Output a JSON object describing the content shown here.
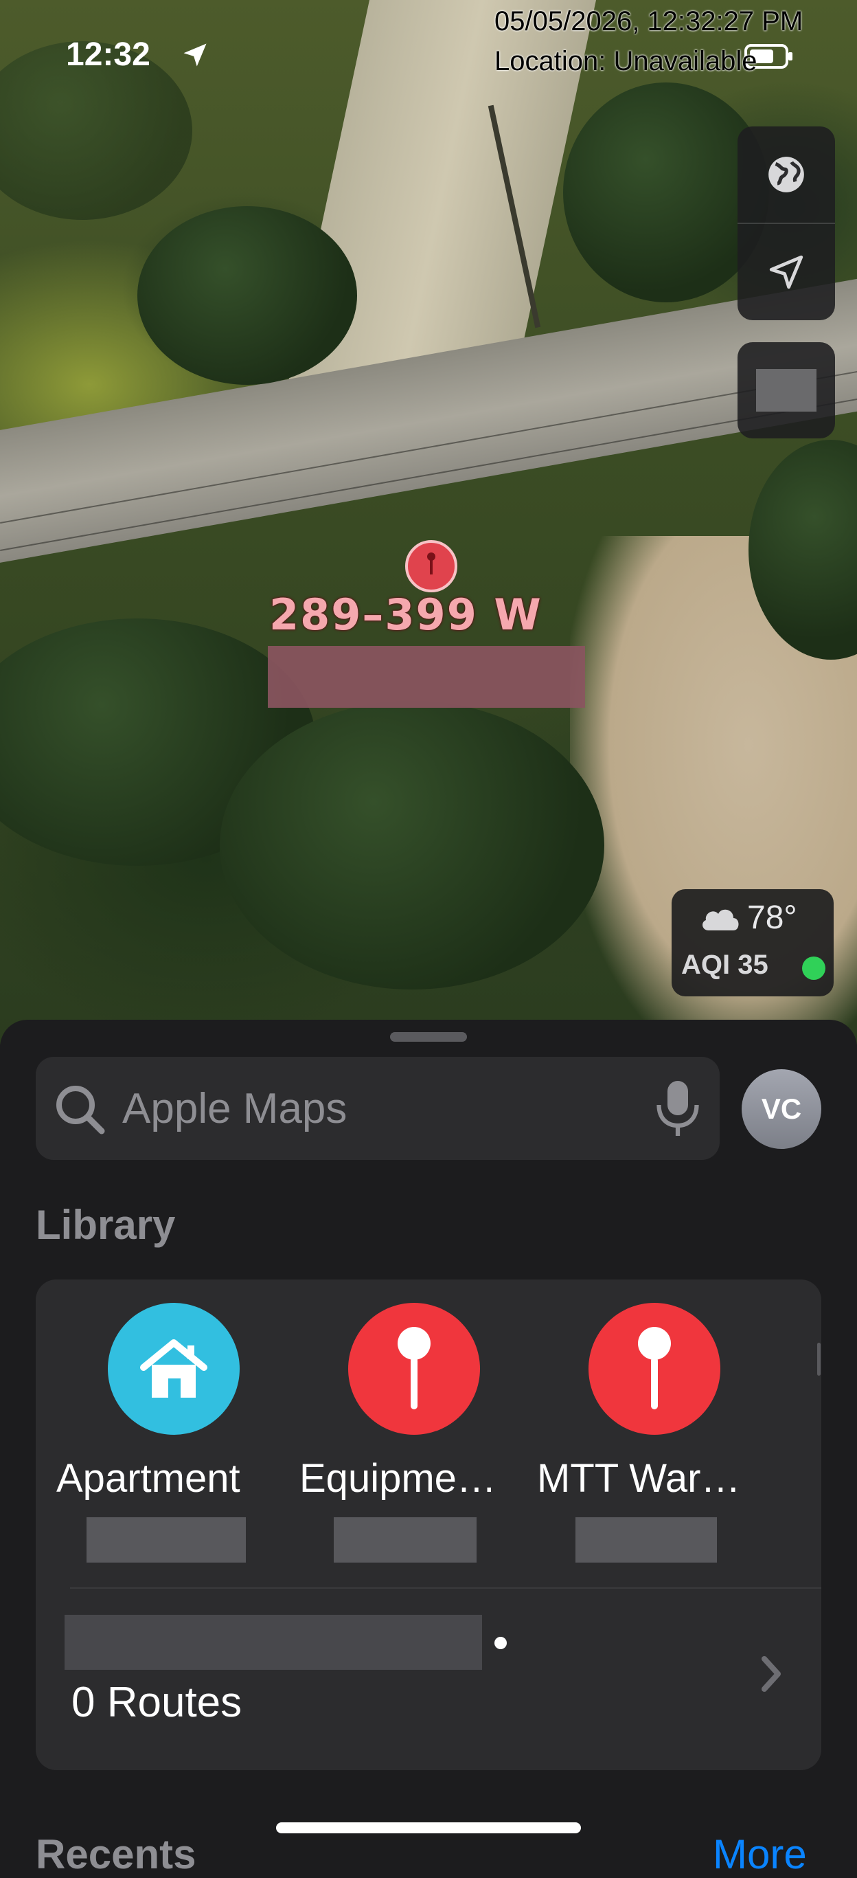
{
  "status_bar": {
    "time": "12:32",
    "overlay_datetime": "05/05/2026, 12:32:27 PM",
    "overlay_location": "Location: Unavailable"
  },
  "map": {
    "pin_label": "289–399 W",
    "map_type_icon": "globe-icon",
    "locate_icon": "location-arrow-icon"
  },
  "weather": {
    "temp": "78°",
    "aqi": "AQI 35",
    "aqi_color": "#30d158"
  },
  "search": {
    "placeholder": "Apple Maps",
    "avatar_initials": "VC"
  },
  "library": {
    "title": "Library",
    "favorites": [
      {
        "label": "Apartment",
        "icon": "house-icon",
        "color": "#32bfe0"
      },
      {
        "label": "Equipme…",
        "icon": "pin-icon",
        "color": "#f0363d"
      },
      {
        "label": "MTT War…",
        "icon": "pin-icon",
        "color": "#f0363d"
      }
    ],
    "routes_label": "0 Routes"
  },
  "recents": {
    "title": "Recents",
    "more_label": "More"
  },
  "colors": {
    "sheet_bg": "#1c1c1e",
    "card_bg": "#2c2c2e",
    "accent": "#0a84ff",
    "pin_red": "#e0434d"
  }
}
